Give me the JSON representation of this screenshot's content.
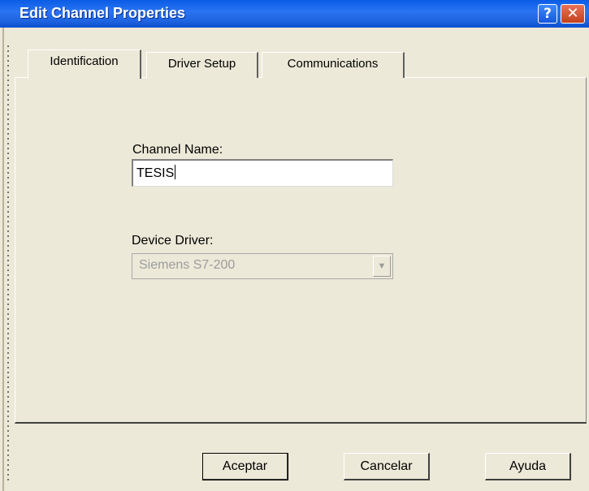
{
  "window": {
    "title": "Edit Channel Properties",
    "help_glyph": "?",
    "close_glyph": "✕"
  },
  "tabs": [
    {
      "label": "Identification",
      "active": true
    },
    {
      "label": "Driver Setup",
      "active": false
    },
    {
      "label": "Communications",
      "active": false
    }
  ],
  "form": {
    "channel_name_label": "Channel Name:",
    "channel_name_value": "TESIS",
    "device_driver_label": "Device Driver:",
    "device_driver_value": "Siemens S7-200",
    "device_driver_enabled": false
  },
  "buttons": {
    "ok": "Aceptar",
    "cancel": "Cancelar",
    "help": "Ayuda"
  },
  "colors": {
    "titlebar": "#0a5ce6",
    "dialog_bg": "#ece9d8",
    "close_button": "#c4401d"
  }
}
